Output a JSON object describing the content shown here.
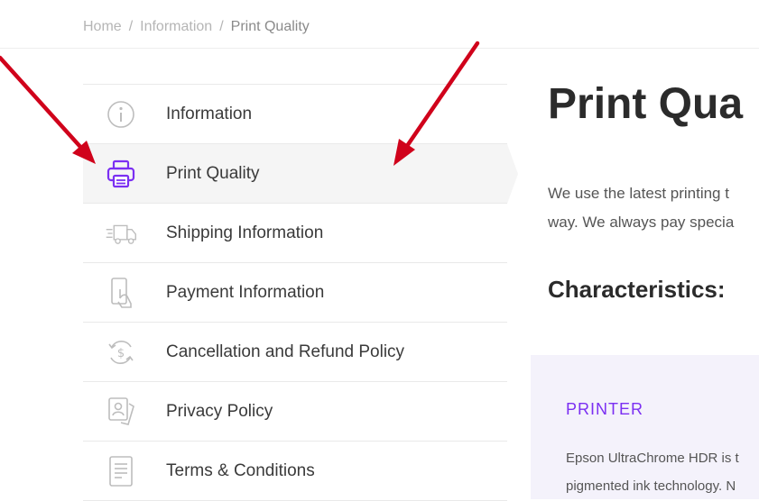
{
  "breadcrumb": {
    "items": [
      "Home",
      "Information",
      "Print Quality"
    ],
    "separator": "/"
  },
  "sidebar": {
    "active_index": 1,
    "items": [
      {
        "label": "Information",
        "icon": "info-icon"
      },
      {
        "label": "Print Quality",
        "icon": "printer-icon"
      },
      {
        "label": "Shipping Information",
        "icon": "truck-icon"
      },
      {
        "label": "Payment Information",
        "icon": "payment-hand-icon"
      },
      {
        "label": "Cancellation and Refund Policy",
        "icon": "refund-icon"
      },
      {
        "label": "Privacy Policy",
        "icon": "privacy-icon"
      },
      {
        "label": "Terms & Conditions",
        "icon": "document-icon"
      }
    ]
  },
  "main": {
    "title": "Print Qua",
    "paragraph_line1": "We use the latest printing t",
    "paragraph_line2": "way. We always pay specia",
    "characteristics_title": "Characteristics:",
    "card": {
      "title": "PRINTER",
      "line1": "Epson UltraChrome HDR is t",
      "line2": "pigmented ink technology. N"
    }
  },
  "colors": {
    "accent": "#7b2ff2",
    "annotation_arrow": "#d0021b",
    "icon_gray": "#bdbdbd",
    "active_bg": "#f5f5f5",
    "card_bg": "#f4f2fb"
  }
}
